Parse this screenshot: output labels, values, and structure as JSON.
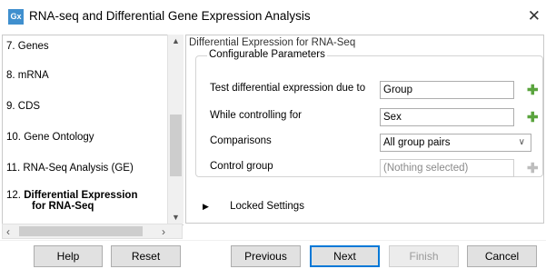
{
  "window": {
    "icon_text": "Gx",
    "title": "RNA-seq and Differential Gene Expression Analysis",
    "close_glyph": "✕"
  },
  "steps": [
    {
      "num": "7.",
      "label": "Genes"
    },
    {
      "num": "8.",
      "label": "mRNA"
    },
    {
      "num": "9.",
      "label": "CDS"
    },
    {
      "num": "10.",
      "label": "Gene Ontology"
    },
    {
      "num": "11.",
      "label": "RNA-Seq Analysis (GE)"
    },
    {
      "num": "12.",
      "label_line1": "Differential Expression",
      "label_line2": "for RNA-Seq",
      "active": true
    }
  ],
  "panel": {
    "title": "Differential Expression for RNA-Seq",
    "group_title": "Configurable Parameters",
    "params": {
      "test_due_to": {
        "label": "Test differential expression due to",
        "value": "Group",
        "add_icon": "plus-icon"
      },
      "controlling_for": {
        "label": "While controlling for",
        "value": "Sex",
        "add_icon": "plus-icon"
      },
      "comparisons": {
        "label": "Comparisons",
        "value": "All group pairs"
      },
      "control_group": {
        "label": "Control group",
        "value": "(Nothing selected)",
        "add_icon": "plus-icon",
        "disabled": true
      }
    },
    "locked_settings": "Locked Settings"
  },
  "buttons": {
    "help": "Help",
    "reset": "Reset",
    "previous": "Previous",
    "next": "Next",
    "finish": "Finish",
    "cancel": "Cancel"
  },
  "colors": {
    "accent": "#0078d7",
    "plus_enabled": "#5aa43e",
    "plus_disabled": "#bdbdbd"
  }
}
